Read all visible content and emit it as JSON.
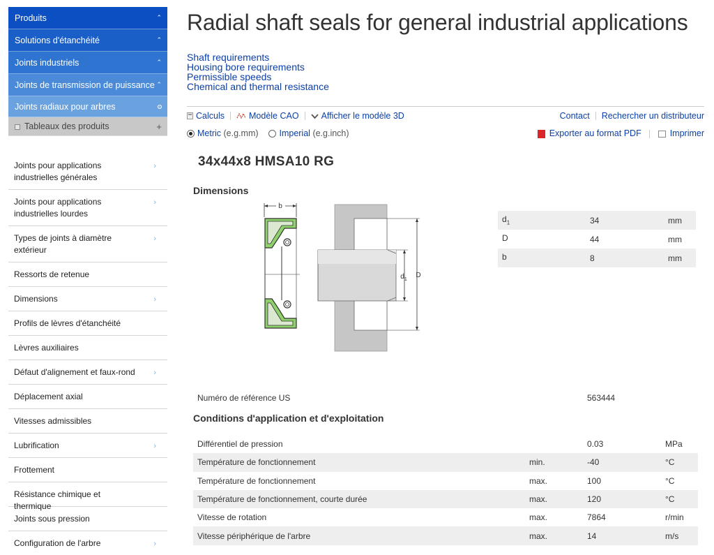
{
  "sidebar": {
    "breadcrumbs": [
      {
        "label": "Produits",
        "marker": "chevron-up"
      },
      {
        "label": "Solutions d'étanchéité",
        "marker": "chevron-up"
      },
      {
        "label": "Joints industriels",
        "marker": "chevron-up"
      },
      {
        "label": "Joints de transmission de puissance",
        "marker": "chevron-up"
      },
      {
        "label": "Joints radiaux pour arbres",
        "marker": "dot"
      },
      {
        "label": "Tableaux des produits",
        "marker": "plus"
      }
    ],
    "items": [
      {
        "label": "Joints pour applications industrielles générales",
        "arrow": true
      },
      {
        "label": "Joints pour applications industrielles lourdes",
        "arrow": true
      },
      {
        "label": "Types de joints à diamètre extérieur",
        "arrow": true
      },
      {
        "label": "Ressorts de retenue",
        "arrow": false
      },
      {
        "label": "Dimensions",
        "arrow": true
      },
      {
        "label": "Profils de lèvres d'étanchéité",
        "arrow": false
      },
      {
        "label": "Lèvres auxiliaires",
        "arrow": false
      },
      {
        "label": "Défaut d'alignement et faux-rond",
        "arrow": true
      },
      {
        "label": "Déplacement axial",
        "arrow": false
      },
      {
        "label": "Vitesses admissibles",
        "arrow": false
      },
      {
        "label": "Lubrification",
        "arrow": true
      },
      {
        "label": "Frottement",
        "arrow": false
      },
      {
        "label": "Résistance chimique et thermique",
        "arrow": false
      },
      {
        "label": "Joints sous pression",
        "arrow": false
      },
      {
        "label": "Configuration de l'arbre",
        "arrow": true
      }
    ]
  },
  "main": {
    "title": "Radial shaft seals for general industrial applications",
    "quicklinks": [
      "Shaft requirements",
      "Housing bore requirements",
      "Permissible speeds",
      "Chemical and thermal resistance"
    ],
    "toolbar": {
      "calculs": "Calculs",
      "cao": "Modèle CAO",
      "model3d": "Afficher le modèle 3D",
      "contact": "Contact",
      "distributor": "Rechercher un distributeur"
    },
    "units": {
      "metric": "Metric",
      "metric_note": "(e.g.mm)",
      "imperial": "Imperial",
      "imperial_note": "(e.g.inch)",
      "selected": "metric"
    },
    "export_pdf": "Exporter au format PDF",
    "print": "Imprimer",
    "product_name": "34x44x8 HMSA10 RG",
    "dimensions_heading": "Dimensions",
    "drawing_labels": {
      "b": "b",
      "d1": "d",
      "d1_sub": "1",
      "D": "D"
    },
    "dimensions": [
      {
        "key": "d",
        "sub": "1",
        "value": "34",
        "unit": "mm"
      },
      {
        "key": "D",
        "sub": "",
        "value": "44",
        "unit": "mm"
      },
      {
        "key": "b",
        "sub": "",
        "value": "8",
        "unit": "mm"
      }
    ],
    "reference": {
      "label": "Numéro de référence US",
      "value": "563444"
    },
    "conditions_heading": "Conditions d'application et d'exploitation",
    "conditions": [
      {
        "label": "Différentiel de pression",
        "qual": "",
        "value": "0.03",
        "unit": "MPa"
      },
      {
        "label": "Température de fonctionnement",
        "qual": "min.",
        "value": "-40",
        "unit": "°C"
      },
      {
        "label": "Température de fonctionnement",
        "qual": "max.",
        "value": "100",
        "unit": "°C"
      },
      {
        "label": "Température de fonctionnement, courte durée",
        "qual": "max.",
        "value": "120",
        "unit": "°C"
      },
      {
        "label": "Vitesse de rotation",
        "qual": "max.",
        "value": "7864",
        "unit": "r/min"
      },
      {
        "label": "Vitesse périphérique de l'arbre",
        "qual": "max.",
        "value": "14",
        "unit": "m/s"
      }
    ]
  }
}
